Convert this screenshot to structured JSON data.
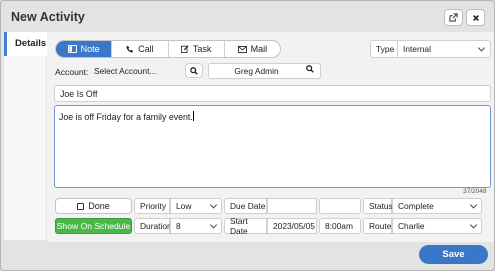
{
  "window": {
    "title": "New Activity"
  },
  "sidebar": {
    "tab_label": "Details"
  },
  "activity_types": [
    {
      "label": "Note",
      "icon": "note-icon",
      "active": true
    },
    {
      "label": "Call",
      "icon": "phone-icon",
      "active": false
    },
    {
      "label": "Task",
      "icon": "edit-icon",
      "active": false
    },
    {
      "label": "Mail",
      "icon": "mail-icon",
      "active": false
    }
  ],
  "type_field": {
    "label": "Type",
    "value": "Internal"
  },
  "account": {
    "label": "Account:",
    "placeholder": "Select Account..."
  },
  "assignee": {
    "value": "Greg Admin"
  },
  "subject": {
    "value": "Joe Is Off"
  },
  "body": {
    "value": "Joe is off Friday for a family event."
  },
  "char_count": "37/2048",
  "done_button": {
    "label": "Done"
  },
  "schedule_button": {
    "label": "Show On Schedule"
  },
  "priority": {
    "label": "Priority",
    "value": "Low"
  },
  "due_date": {
    "label": "Due Date",
    "date": "",
    "time": ""
  },
  "status": {
    "label": "Status",
    "value": "Complete"
  },
  "duration": {
    "label": "Duration",
    "value": "8"
  },
  "start_date": {
    "label": "Start Date",
    "date": "2023/05/05",
    "time": "8:00am"
  },
  "route": {
    "label": "Route",
    "value": "Charlie"
  },
  "save_button": {
    "label": "Save"
  },
  "colors": {
    "primary": "#3b77c9",
    "success": "#4db649",
    "focus_border": "#6d9bd6"
  }
}
